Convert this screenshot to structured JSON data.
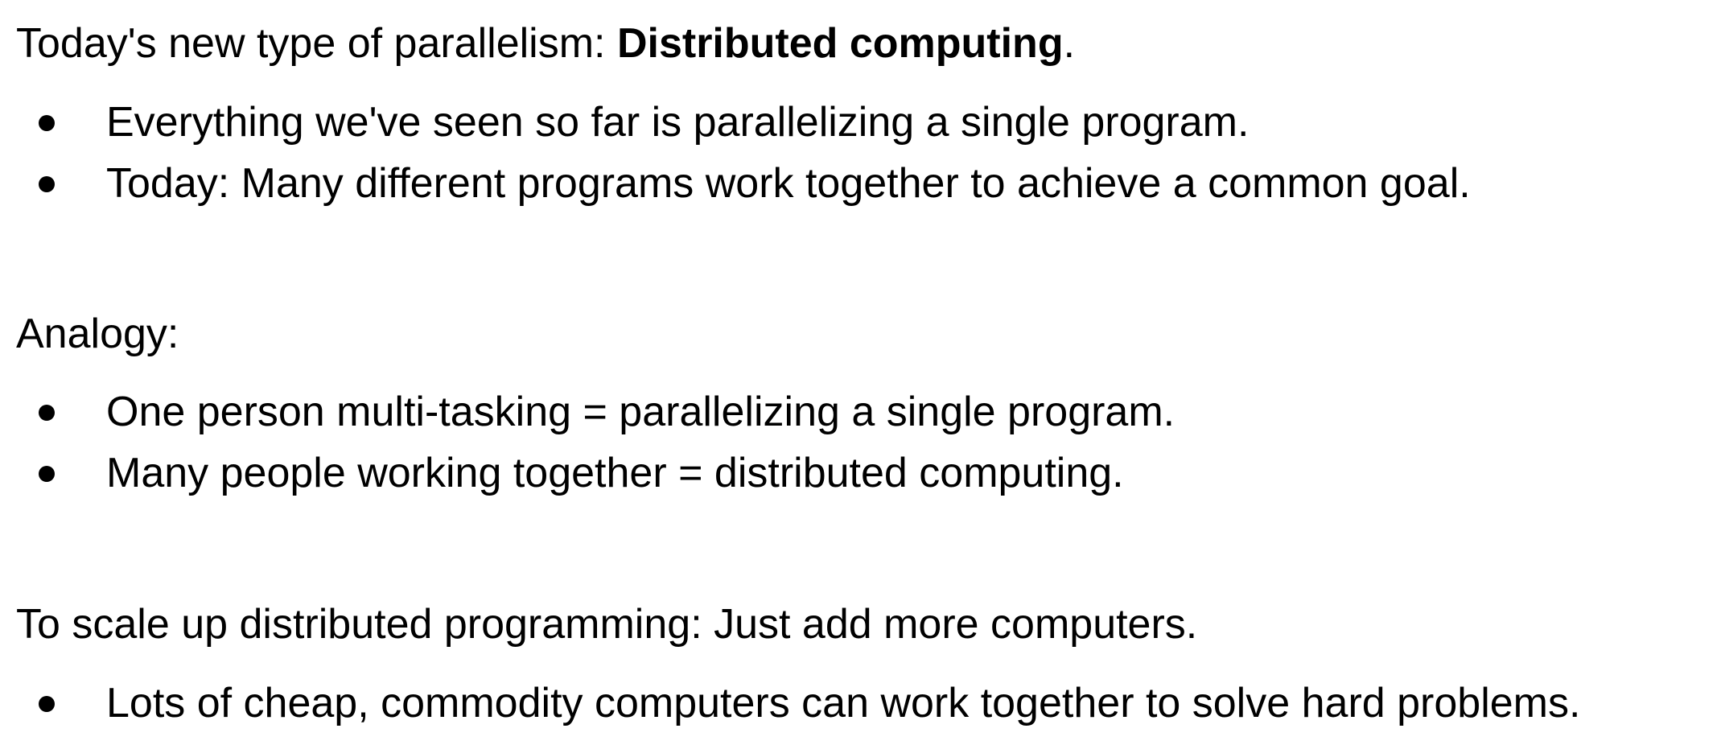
{
  "section1": {
    "intro_prefix": "Today's new type of parallelism: ",
    "intro_bold": "Distributed computing",
    "intro_suffix": ".",
    "bullets": [
      "Everything we've seen so far is parallelizing a single program.",
      "Today: Many different programs work together to achieve a common goal."
    ]
  },
  "section2": {
    "heading": "Analogy:",
    "bullets": [
      "One person multi-tasking = parallelizing a single program.",
      "Many people working together = distributed computing."
    ]
  },
  "section3": {
    "heading": "To scale up distributed programming: Just add more computers.",
    "bullets": [
      "Lots of cheap, commodity computers can work together to solve hard problems."
    ]
  }
}
